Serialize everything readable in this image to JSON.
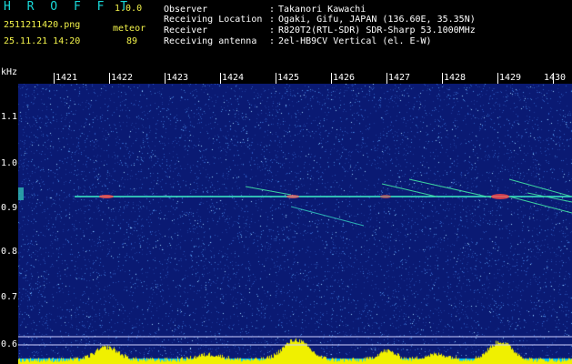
{
  "header": {
    "title": "H R O F F T",
    "version": "1.0.0",
    "filename": "2511211420.png",
    "datetime": "25.11.21 14:20",
    "meteor_label": "meteor",
    "meteor_count": "89",
    "info": [
      {
        "label": "Observer",
        "value": "Takanori Kawachi"
      },
      {
        "label": "Receiving Location",
        "value": "Ogaki, Gifu, JAPAN (136.60E, 35.35N)"
      },
      {
        "label": "Receiver",
        "value": "R820T2(RTL-SDR) SDR-Sharp 53.1000MHz"
      },
      {
        "label": "Receiving antenna",
        "value": "2el-HB9CV Vertical (el. E-W)"
      }
    ]
  },
  "axes": {
    "y_unit": "kHz",
    "x_ticks": [
      "1421",
      "1422",
      "1423",
      "1424",
      "1425",
      "1426",
      "1427",
      "1428",
      "1429",
      "1430"
    ],
    "y_ticks": [
      "1.1",
      "1.0",
      "0.9",
      "0.8",
      "0.7",
      "0.6"
    ]
  },
  "colors": {
    "background_noise": "#0a1a73",
    "carrier_line": "#3cf0c8",
    "meteor_hot": "#ff4646",
    "level_bar": "#f0f000",
    "level_base": "#00c8ff"
  }
}
